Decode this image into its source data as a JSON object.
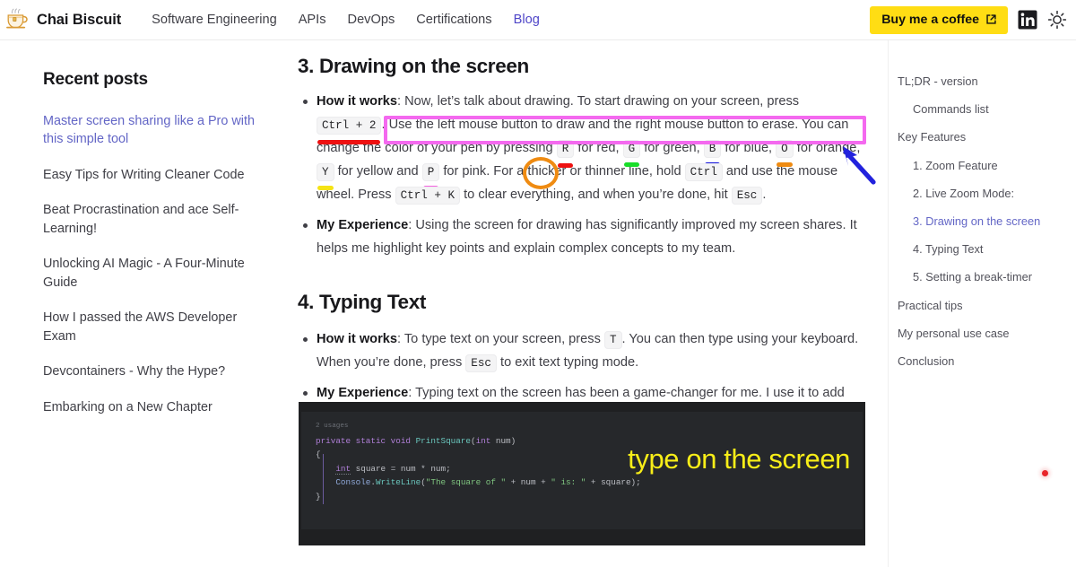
{
  "header": {
    "logo_icon": "chai-cup-icon",
    "brand": "Chai Biscuit",
    "nav": [
      {
        "label": "Software Engineering",
        "active": false
      },
      {
        "label": "APIs",
        "active": false
      },
      {
        "label": "DevOps",
        "active": false
      },
      {
        "label": "Certifications",
        "active": false
      },
      {
        "label": "Blog",
        "active": true
      }
    ],
    "coffee_button": {
      "label": "Buy me a coffee",
      "icon": "external-link-icon",
      "bg": "#ffdd14"
    },
    "linkedin_icon": "linkedin-icon",
    "theme_toggle_icon": "sun-icon"
  },
  "sidebar": {
    "title": "Recent posts",
    "posts": [
      {
        "label": "Master screen sharing like a Pro with this simple tool",
        "active": true
      },
      {
        "label": "Easy Tips for Writing Cleaner Code",
        "active": false
      },
      {
        "label": "Beat Procrastination and ace Self-Learning!",
        "active": false
      },
      {
        "label": "Unlocking AI Magic - A Four-Minute Guide",
        "active": false
      },
      {
        "label": "How I passed the AWS Developer Exam",
        "active": false
      },
      {
        "label": "Devcontainers - Why the Hype?",
        "active": false
      },
      {
        "label": "Embarking on a New Chapter",
        "active": false
      }
    ]
  },
  "article": {
    "section3": {
      "heading": "3. Drawing on the screen",
      "how_it_works": {
        "lead": "How it works",
        "t1": ": Now, let’s talk about drawing. To start drawing on your screen, press ",
        "key_ctrl2": "Ctrl + 2",
        "t2": ". Use the left mouse button to draw and the right mouse button to erase. You can change the color of your pen by pressing ",
        "key_r": "R",
        "t3": " for red, ",
        "key_g": "G",
        "t4": " for green, ",
        "key_b": "B",
        "t5": " for blue, ",
        "key_o": "O",
        "t6": " for orange, ",
        "key_y": "Y",
        "t7": " for yellow and ",
        "key_p": "P",
        "t8": " for pink. For a thicker or thinner line, hold ",
        "key_ctrl": "Ctrl",
        "t9": " and use the mouse wheel. Press ",
        "key_ctrlk": "Ctrl + K",
        "t10": " to clear everything, and when you’re done, hit ",
        "key_esc": "Esc",
        "t11": "."
      },
      "my_experience": {
        "lead": "My Experience",
        "text": ": Using the screen for drawing has significantly improved my screen shares. It helps me highlight key points and explain complex concepts to my team."
      }
    },
    "section4": {
      "heading": "4. Typing Text",
      "how_it_works": {
        "lead": "How it works",
        "t1": ": To type text on your screen, press ",
        "key_t": "T",
        "t2": ". You can then type using your keyboard. When you’re done, press ",
        "key_esc": "Esc",
        "t3": " to exit text typing mode."
      },
      "my_experience": {
        "lead": "My Experience",
        "text": ": Typing text on the screen has been a game-changer for me. I use it to add comments to my code during pair programming sessions, and it has been a massive help in explaining my thought process to my team."
      }
    }
  },
  "code_screenshot": {
    "usages_label": "2 usages",
    "line1_kw": "private static void ",
    "line1_fn": "PrintSquare",
    "line1_p1": "(",
    "line1_type": "int",
    "line1_arg": " num",
    "line1_p2": ")",
    "line2": "{",
    "line3_type": "int",
    "line3_rest": " square = num * num;",
    "line4_obj": "Console",
    "line4_dot": ".",
    "line4_fn": "WriteLine",
    "line4_open": "(",
    "line4_s1": "\"The square of \"",
    "line4_m1": " + num + ",
    "line4_s2": "\" is: \"",
    "line4_m2": " + square);",
    "line5": "}",
    "line6": "}",
    "overlay_text": "type on the screen",
    "overlay_color": "#f8ee18"
  },
  "annotations": {
    "pink_rect_color": "#f469ef",
    "orange_circle_color": "#ef8b12",
    "blue_arrow_color": "#2222dd",
    "red_dot_color": "#e8252a",
    "underline_colors": {
      "red": "#ee1111",
      "green": "#19dd2a",
      "blue": "#1414dd",
      "orange": "#ef8b12",
      "yellow": "#f5e315",
      "pink": "#f462e0"
    }
  },
  "toc": {
    "items": [
      {
        "label": "TL;DR - version",
        "sub": false,
        "active": false
      },
      {
        "label": "Commands list",
        "sub": true,
        "active": false
      },
      {
        "label": "Key Features",
        "sub": false,
        "active": false
      },
      {
        "label": "1. Zoom Feature",
        "sub": true,
        "active": false
      },
      {
        "label": "2. Live Zoom Mode:",
        "sub": true,
        "active": false
      },
      {
        "label": "3. Drawing on the screen",
        "sub": true,
        "active": true
      },
      {
        "label": "4. Typing Text",
        "sub": true,
        "active": false
      },
      {
        "label": "5. Setting a break-timer",
        "sub": true,
        "active": false
      },
      {
        "label": "Practical tips",
        "sub": false,
        "active": false
      },
      {
        "label": "My personal use case",
        "sub": false,
        "active": false
      },
      {
        "label": "Conclusion",
        "sub": false,
        "active": false
      }
    ]
  }
}
